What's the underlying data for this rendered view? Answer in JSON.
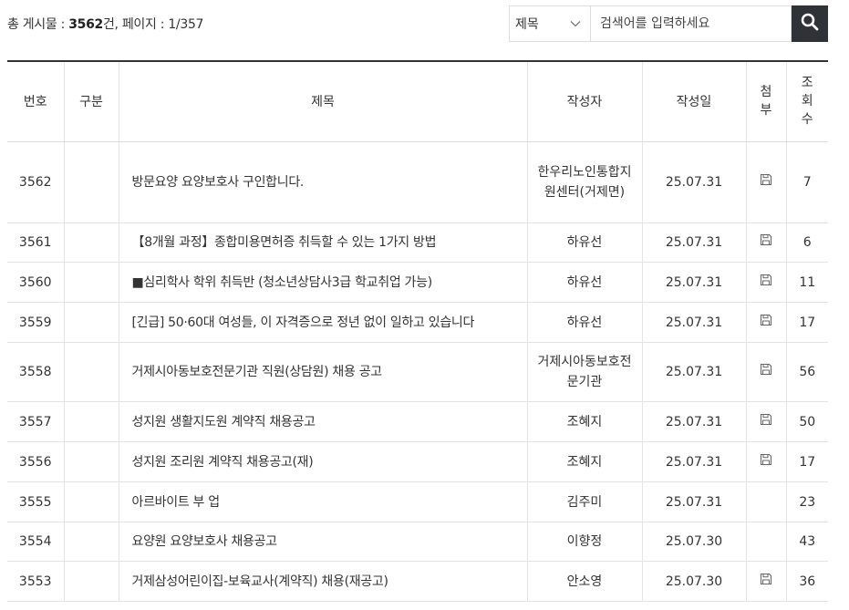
{
  "summary": {
    "label_total": "총 게시물 : ",
    "total_count": "3562",
    "unit": "건, ",
    "label_page": "페이지 : ",
    "page": "1/357"
  },
  "search": {
    "field_selected": "제목",
    "placeholder": "검색어를 입력하세요",
    "search_icon": "search-icon"
  },
  "columns": {
    "no": "번호",
    "category": "구분",
    "title": "제목",
    "writer": "작성자",
    "date": "작성일",
    "attach_1": "첨",
    "attach_2": "부",
    "views_1": "조",
    "views_2": "회",
    "views_3": "수"
  },
  "rows": [
    {
      "no": "3562",
      "category": "",
      "title": "방문요양 요양보호사 구인합니다.",
      "writer": "한우리노인통합지원센터(거제면)",
      "date": "25.07.31",
      "attach": true,
      "views": "7"
    },
    {
      "no": "3561",
      "category": "",
      "title": "【8개월 과정】종합미용면허증 취득할 수 있는 1가지 방법",
      "writer": "하유선",
      "date": "25.07.31",
      "attach": true,
      "views": "6"
    },
    {
      "no": "3560",
      "category": "",
      "title": "■심리학사 학위 취득반 (청소년상담사3급 학교취업 가능)",
      "writer": "하유선",
      "date": "25.07.31",
      "attach": true,
      "views": "11"
    },
    {
      "no": "3559",
      "category": "",
      "title": "[긴급] 50·60대 여성들, 이 자격증으로 정년 없이 일하고 있습니다",
      "writer": "하유선",
      "date": "25.07.31",
      "attach": true,
      "views": "17"
    },
    {
      "no": "3558",
      "category": "",
      "title": "거제시아동보호전문기관 직원(상담원) 채용 공고",
      "writer": "거제시아동보호전문기관",
      "date": "25.07.31",
      "attach": true,
      "views": "56"
    },
    {
      "no": "3557",
      "category": "",
      "title": "성지원 생활지도원 계약직 채용공고",
      "writer": "조혜지",
      "date": "25.07.31",
      "attach": true,
      "views": "50"
    },
    {
      "no": "3556",
      "category": "",
      "title": "성지원 조리원 계약직 채용공고(재)",
      "writer": "조혜지",
      "date": "25.07.31",
      "attach": true,
      "views": "17"
    },
    {
      "no": "3555",
      "category": "",
      "title": "아르바이트 부 업",
      "writer": "김주미",
      "date": "25.07.31",
      "attach": false,
      "views": "23"
    },
    {
      "no": "3554",
      "category": "",
      "title": "요양원 요양보호사 채용공고",
      "writer": "이향정",
      "date": "25.07.30",
      "attach": false,
      "views": "43"
    },
    {
      "no": "3553",
      "category": "",
      "title": "거제삼성어린이집-보육교사(계약직) 채용(재공고)",
      "writer": "안소영",
      "date": "25.07.30",
      "attach": true,
      "views": "36"
    }
  ],
  "colors": {
    "header_border": "#333333",
    "search_button": "#2f3338"
  }
}
